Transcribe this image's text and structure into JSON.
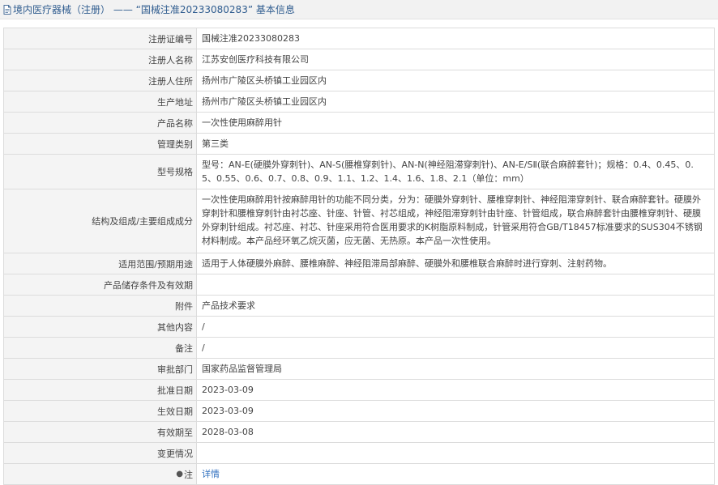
{
  "header": {
    "title": "境内医疗器械（注册） —— “国械注准20233080283” 基本信息"
  },
  "rows": [
    {
      "label": "注册证编号",
      "value": "国械注准20233080283"
    },
    {
      "label": "注册人名称",
      "value": "江苏安创医疗科技有限公司"
    },
    {
      "label": "注册人住所",
      "value": "扬州市广陵区头桥镇工业园区内"
    },
    {
      "label": "生产地址",
      "value": "扬州市广陵区头桥镇工业园区内"
    },
    {
      "label": "产品名称",
      "value": "一次性使用麻醉用针"
    },
    {
      "label": "管理类别",
      "value": "第三类"
    },
    {
      "label": "型号规格",
      "value": "型号：AN-E(硬膜外穿刺针)、AN-S(腰椎穿刺针)、AN-N(神经阻滞穿刺针)、AN-E/SⅡ(联合麻醉套针)；规格：0.4、0.45、0.5、0.55、0.6、0.7、0.8、0.9、1.1、1.2、1.4、1.6、1.8、2.1（单位：mm）"
    },
    {
      "label": "结构及组成/主要组成成分",
      "value": "一次性使用麻醉用针按麻醉用针的功能不同分类，分为：硬膜外穿刺针、腰椎穿刺针、神经阻滞穿刺针、联合麻醉套针。硬膜外穿刺针和腰椎穿刺针由衬芯座、针座、针管、衬芯组成，神经阻滞穿刺针由针座、针管组成，联合麻醉套针由腰椎穿刺针、硬膜外穿刺针组成。衬芯座、衬芯、针座采用符合医用要求的K树脂原料制成，针管采用符合GB/T18457标准要求的SUS304不锈钢材料制成。本产品经环氧乙烷灭菌，应无菌、无热原。本产品一次性使用。"
    },
    {
      "label": "适用范围/预期用途",
      "value": "适用于人体硬膜外麻醉、腰椎麻醉、神经阻滞局部麻醉、硬膜外和腰椎联合麻醉时进行穿刺、注射药物。"
    },
    {
      "label": "产品储存条件及有效期",
      "value": ""
    },
    {
      "label": "附件",
      "value": "产品技术要求"
    },
    {
      "label": "其他内容",
      "value": "/"
    },
    {
      "label": "备注",
      "value": "/"
    },
    {
      "label": "审批部门",
      "value": "国家药品监督管理局"
    },
    {
      "label": "批准日期",
      "value": "2023-03-09"
    },
    {
      "label": "生效日期",
      "value": "2023-03-09"
    },
    {
      "label": "有效期至",
      "value": "2028-03-08"
    },
    {
      "label": "变更情况",
      "value": ""
    },
    {
      "label": "注",
      "value": "详情"
    }
  ],
  "colors": {
    "header_bg": "#f2f2f2",
    "header_text": "#2f5c8f",
    "label_bg": "#f4f4f4",
    "border": "#dcdcdc",
    "link": "#2f6fbf"
  },
  "icons": {
    "header": "document-icon",
    "note": "map-pin-icon"
  }
}
